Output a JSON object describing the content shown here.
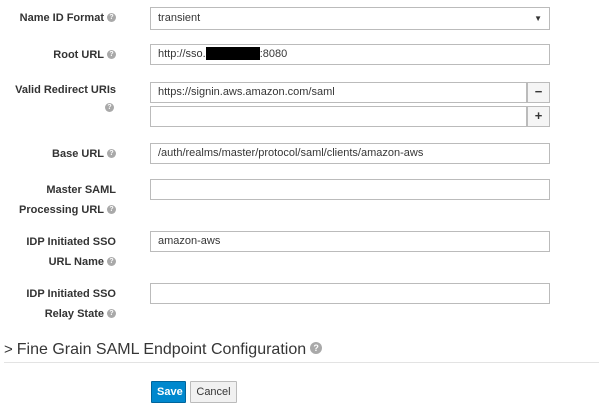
{
  "form": {
    "name_id_format": {
      "label": "Name ID Format",
      "value": "transient"
    },
    "root_url": {
      "label": "Root URL",
      "value_prefix": "http://sso.",
      "value_suffix": ":8080"
    },
    "valid_redirect_uris": {
      "label_line1": "Valid Redirect URIs",
      "values": [
        "https://signin.aws.amazon.com/saml",
        ""
      ],
      "remove_label": "−",
      "add_label": "+"
    },
    "base_url": {
      "label": "Base URL",
      "value": "/auth/realms/master/protocol/saml/clients/amazon-aws"
    },
    "master_saml_processing_url": {
      "label_line1": "Master SAML",
      "label_line2": "Processing URL",
      "value": ""
    },
    "idp_initiated_sso_url_name": {
      "label_line1": "IDP Initiated SSO",
      "label_line2": "URL Name",
      "value": "amazon-aws"
    },
    "idp_initiated_sso_relay_state": {
      "label_line1": "IDP Initiated SSO",
      "label_line2": "Relay State",
      "value": ""
    }
  },
  "section": {
    "title": "Fine Grain SAML Endpoint Configuration"
  },
  "actions": {
    "save_label": "Save",
    "cancel_label": "Cancel"
  },
  "icons": {
    "help": "question-circle-icon",
    "caret": "caret-down-icon",
    "chevron": "chevron-right-icon"
  },
  "colors": {
    "primary": "#0088ce",
    "help_icon": "#a9a9a9"
  }
}
